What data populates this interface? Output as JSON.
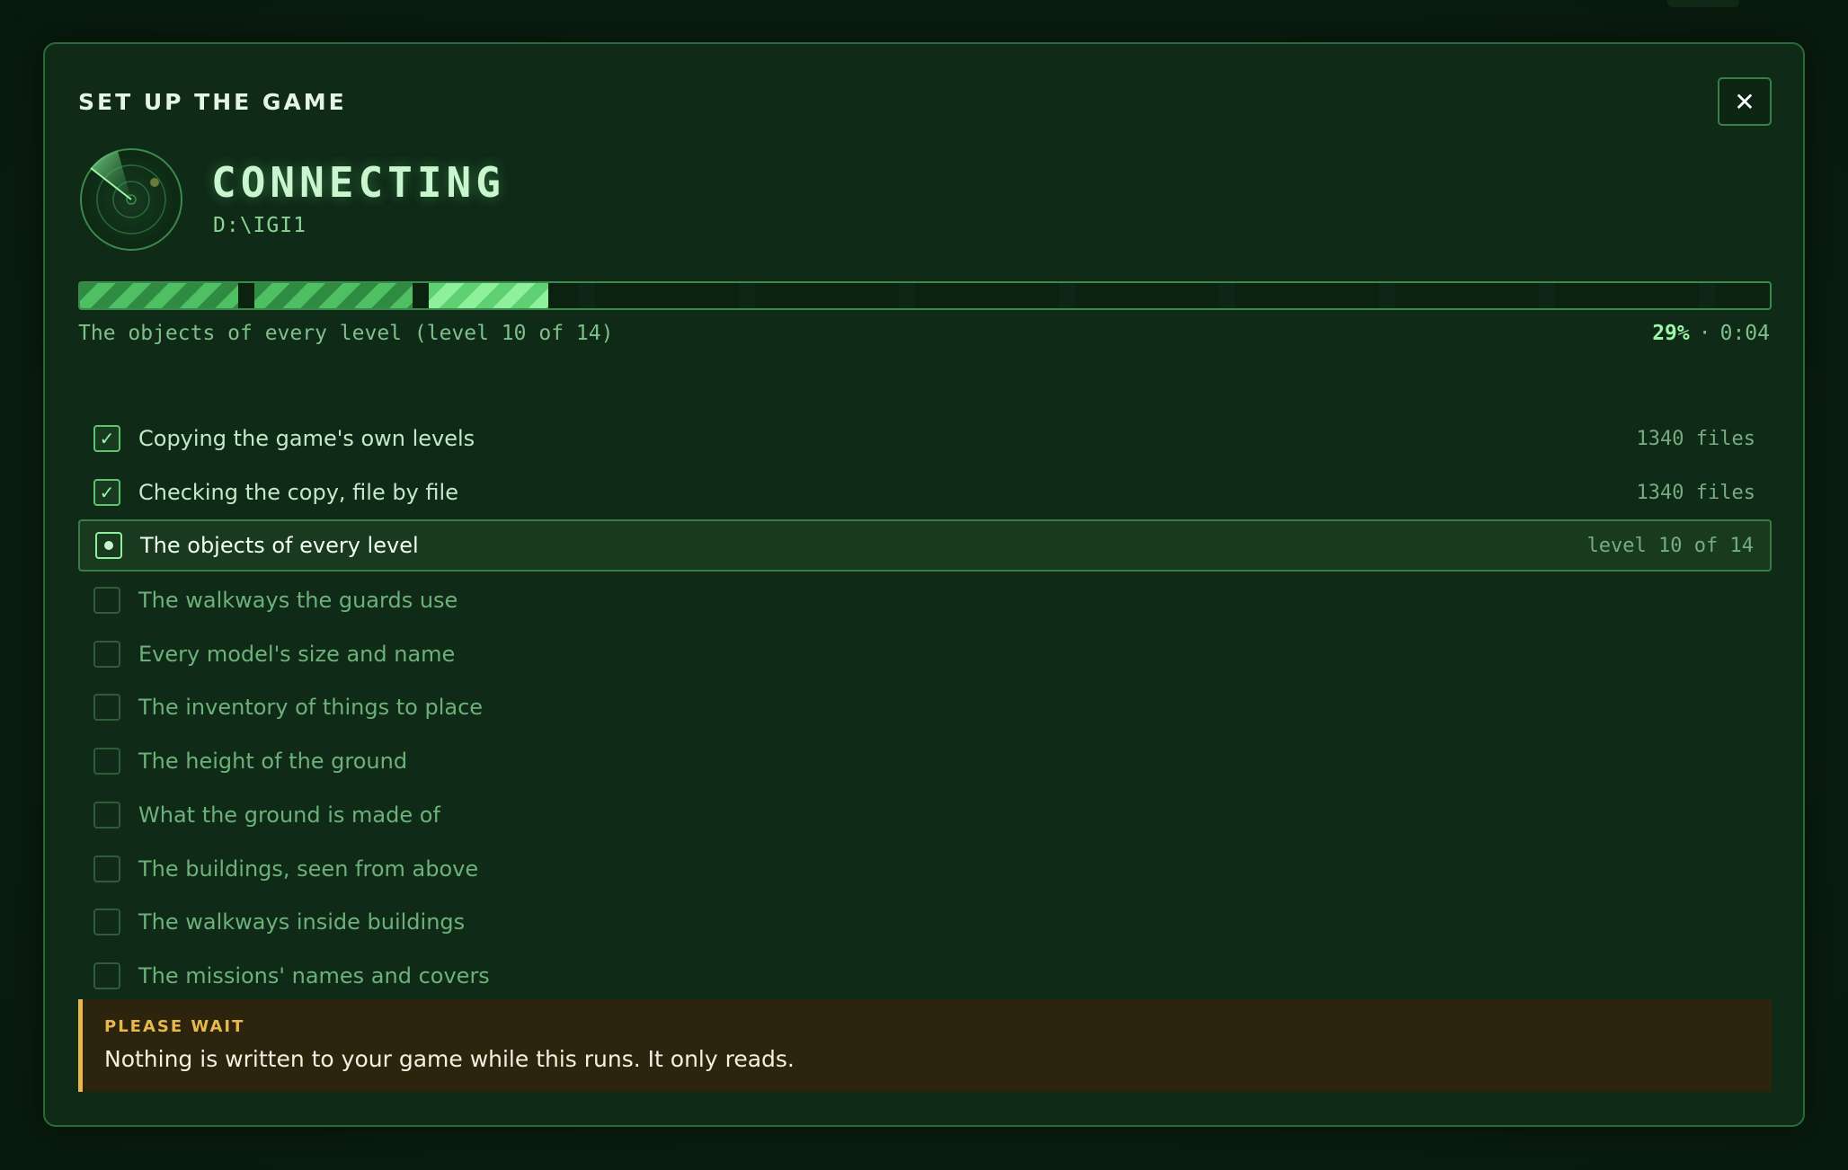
{
  "modal": {
    "title": "SET UP THE GAME",
    "close_label": "✕"
  },
  "status": {
    "title": "CONNECTING",
    "path": "D:\\IGI1",
    "icon": "radar-icon"
  },
  "progress": {
    "caption": "The objects of every level (level 10 of 14)",
    "percent_label": "29%",
    "separator": "·",
    "elapsed": "0:04",
    "percent_value": 0.29
  },
  "steps": [
    {
      "label": "Copying the game's own levels",
      "detail": "1340 files",
      "state": "done"
    },
    {
      "label": "Checking the copy, file by file",
      "detail": "1340 files",
      "state": "done"
    },
    {
      "label": "The objects of every level",
      "detail": "level 10 of 14",
      "state": "active"
    },
    {
      "label": "The walkways the guards use",
      "detail": "",
      "state": "pending"
    },
    {
      "label": "Every model's size and name",
      "detail": "",
      "state": "pending"
    },
    {
      "label": "The inventory of things to place",
      "detail": "",
      "state": "pending"
    },
    {
      "label": "The height of the ground",
      "detail": "",
      "state": "pending"
    },
    {
      "label": "What the ground is made of",
      "detail": "",
      "state": "pending"
    },
    {
      "label": "The buildings, seen from above",
      "detail": "",
      "state": "pending"
    },
    {
      "label": "The walkways inside buildings",
      "detail": "",
      "state": "pending"
    },
    {
      "label": "The missions' names and covers",
      "detail": "",
      "state": "pending"
    }
  ],
  "notice": {
    "title": "PLEASE WAIT",
    "text": "Nothing is written to your game while this runs. It only reads."
  },
  "colors": {
    "accent": "#8ef09d",
    "warning": "#e6b84d",
    "panel": "#0f2a17"
  }
}
